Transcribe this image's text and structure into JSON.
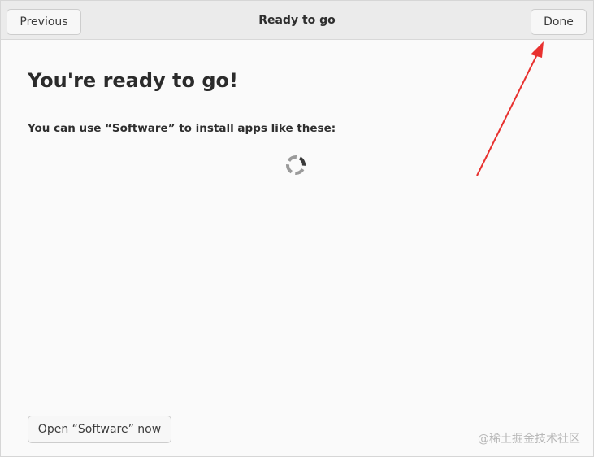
{
  "header": {
    "title": "Ready to go",
    "previous_label": "Previous",
    "done_label": "Done"
  },
  "main": {
    "title": "You're ready to go!",
    "subtitle": "You can use “Software” to install apps like these:",
    "loading_icon": "spinner-icon",
    "open_software_label": "Open “Software” now"
  },
  "overlay": {
    "watermark": "@稀土掘金技术社区",
    "annotation_arrow_color": "#e8312f"
  },
  "colors": {
    "headerbar": "#ebebeb",
    "content_bg": "#fafafa",
    "text": "#2b2b2b"
  }
}
